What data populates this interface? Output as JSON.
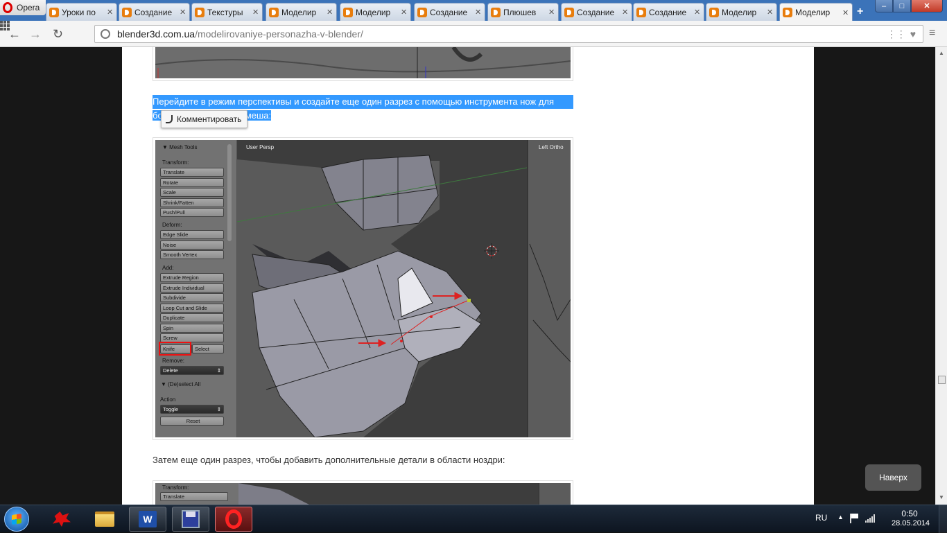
{
  "browser": {
    "menu_label": "Opera",
    "tabs": [
      {
        "label": "Уроки по"
      },
      {
        "label": "Создание"
      },
      {
        "label": "Текстуры"
      },
      {
        "label": "Моделир"
      },
      {
        "label": "Моделир"
      },
      {
        "label": "Создание"
      },
      {
        "label": "Плюшев"
      },
      {
        "label": "Создание"
      },
      {
        "label": "Создание"
      },
      {
        "label": "Моделир"
      },
      {
        "label": "Моделир"
      }
    ],
    "new_tab_label": "+",
    "window_controls": {
      "minimize": "–",
      "maximize": "□",
      "close": "✕"
    },
    "address": {
      "host": "blender3d.com.ua",
      "path": "/modelirovaniye-personazha-v-blender/"
    },
    "nav": {
      "back": "←",
      "forward": "→",
      "reload": "↻",
      "menu": "≡"
    }
  },
  "article": {
    "paragraph1_line1": "Перейдите в режим перспективы и создайте еще один разрез с помощью инструмента нож для",
    "paragraph1_line2_start": "бо",
    "paragraph1_line2_end": "меша:",
    "comment_popup": "Комментировать",
    "paragraph2": "Затем еще один разрез, чтобы добавить дополнительные детали в области ноздри:",
    "back_to_top": "Наверх"
  },
  "blender_shot": {
    "panel_title": "▼ Mesh Tools",
    "view_label_left": "User Persp",
    "view_label_right": "Left Ortho",
    "sections": {
      "transform": "Transform:",
      "deform": "Deform:",
      "add": "Add:",
      "remove": "Remove:",
      "deselect": "▼ (De)select All",
      "action": "Action"
    },
    "transform_buttons": [
      "Translate",
      "Rotate",
      "Scale",
      "Shrink/Fatten",
      "Push/Pull"
    ],
    "deform_buttons": [
      "Edge Slide",
      "Noise",
      "Smooth Vertex"
    ],
    "add_buttons": [
      "Extrude Region",
      "Extrude Individual",
      "Subdivide",
      "Loop Cut and Slide",
      "Duplicate",
      "Spin",
      "Screw"
    ],
    "knife_label": "Knife",
    "select_label": "Select",
    "delete_value": "Delete",
    "toggle_value": "Toggle",
    "reset_label": "Reset"
  },
  "blender_shot2": {
    "section_transform": "Transform:",
    "first_button": "Translate"
  },
  "taskbar": {
    "language": "RU",
    "time": "0:50",
    "date": "28.05.2014"
  },
  "colors": {
    "selection": "#3399ff",
    "tab_bar": "#3b73b9",
    "red_marker": "#dd2222"
  }
}
